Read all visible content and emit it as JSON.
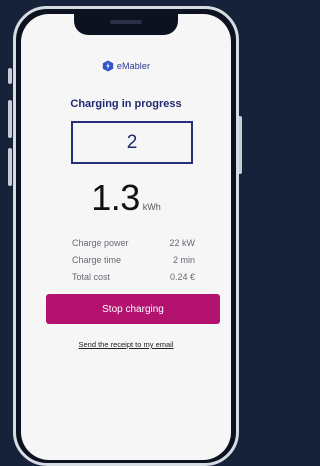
{
  "app": {
    "logo_text": "eMabler"
  },
  "session": {
    "title": "Charging in progress",
    "connector_code": "2",
    "energy_value": "1.3",
    "energy_unit": "kWh"
  },
  "stats": [
    {
      "label": "Charge power",
      "value": "22 kW"
    },
    {
      "label": "Charge time",
      "value": "2 min"
    },
    {
      "label": "Total cost",
      "value": "0.24 €"
    }
  ],
  "actions": {
    "stop_label": "Stop charging",
    "receipt_link": "Send the receipt to my email"
  },
  "colors": {
    "brand_blue": "#1f2a6e",
    "accent_magenta": "#b3126f",
    "background_navy": "#16213a"
  }
}
